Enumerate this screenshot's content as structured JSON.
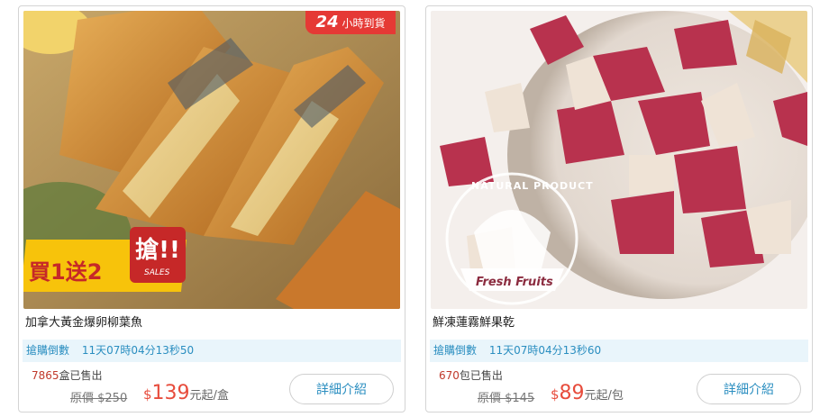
{
  "products": [
    {
      "title": "加拿大黃金爆卵柳葉魚",
      "countdown_label": "搶購倒數",
      "countdown_value": "11天07時04分13秒50",
      "sold_count": "7865",
      "sold_suffix": "盒已售出",
      "orig_price": "原價 $250",
      "price_currency": "$",
      "price_value": "139",
      "price_unit": "元起/盒",
      "detail_label": "詳細介紹",
      "tag_24_big": "24",
      "tag_24_text": "小時到貨",
      "promo_text": "買1送2",
      "promo_grab": "搶!!",
      "promo_sales": "SALES"
    },
    {
      "title": "鮮凍蓮霧鮮果乾",
      "countdown_label": "搶購倒數",
      "countdown_value": "11天07時04分13秒60",
      "sold_count": "670",
      "sold_suffix": "包已售出",
      "orig_price": "原價 $145",
      "price_currency": "$",
      "price_value": "89",
      "price_unit": "元起/包",
      "detail_label": "詳細介紹",
      "logo_top": "NATURAL PRODUCT",
      "logo_bottom": "Fresh Fruits"
    }
  ],
  "colors": {
    "accent": "#2a8ec0",
    "price": "#e74c3c",
    "tag_red": "#e53935",
    "promo_yellow": "#f7c30b"
  }
}
